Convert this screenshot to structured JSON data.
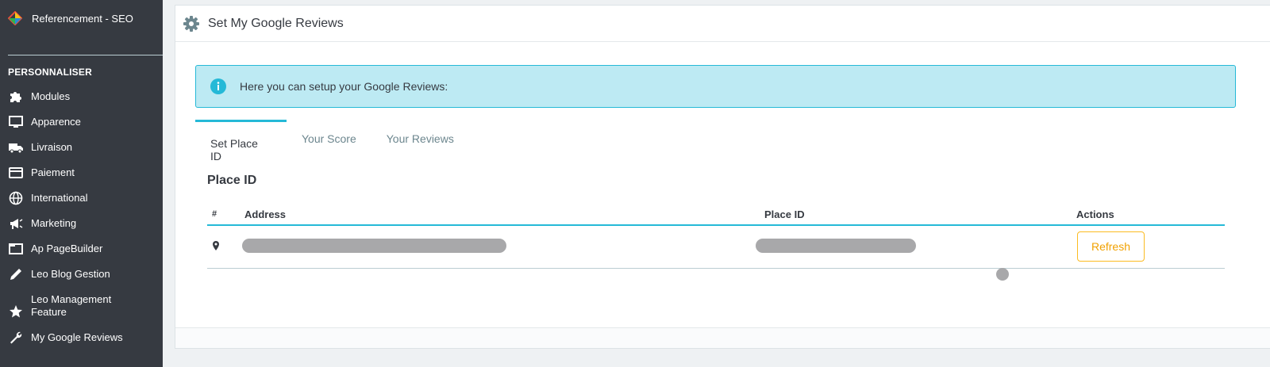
{
  "sidebar": {
    "top_item": "Referencement - SEO",
    "section_title": "PERSONNALISER",
    "items": [
      {
        "label": "Modules",
        "icon": "puzzle-icon"
      },
      {
        "label": "Apparence",
        "icon": "monitor-icon"
      },
      {
        "label": "Livraison",
        "icon": "truck-icon"
      },
      {
        "label": "Paiement",
        "icon": "credit-card-icon"
      },
      {
        "label": "International",
        "icon": "globe-icon"
      },
      {
        "label": "Marketing",
        "icon": "megaphone-icon"
      },
      {
        "label": "Ap PageBuilder",
        "icon": "window-icon"
      },
      {
        "label": "Leo Blog Gestion",
        "icon": "pencil-icon"
      },
      {
        "label": "Leo Management Feature",
        "icon": "star-icon"
      },
      {
        "label": "My Google Reviews",
        "icon": "wrench-icon"
      }
    ]
  },
  "panel": {
    "title": "Set My Google Reviews",
    "alert": "Here you can setup your Google Reviews:",
    "tabs": [
      {
        "label": "Set Place ID",
        "active": true
      },
      {
        "label": "Your Score",
        "active": false
      },
      {
        "label": "Your Reviews",
        "active": false
      }
    ],
    "section_title": "Place ID",
    "table": {
      "headers": [
        "#",
        "Address",
        "Place ID",
        "Actions"
      ],
      "rows": [
        {
          "address": "",
          "place_id": "",
          "action": "Refresh"
        }
      ]
    }
  },
  "colors": {
    "sidebar_bg": "#363a41",
    "accent": "#25b9d7",
    "alert_bg": "#bdeaf3",
    "refresh": "#f1a100"
  }
}
